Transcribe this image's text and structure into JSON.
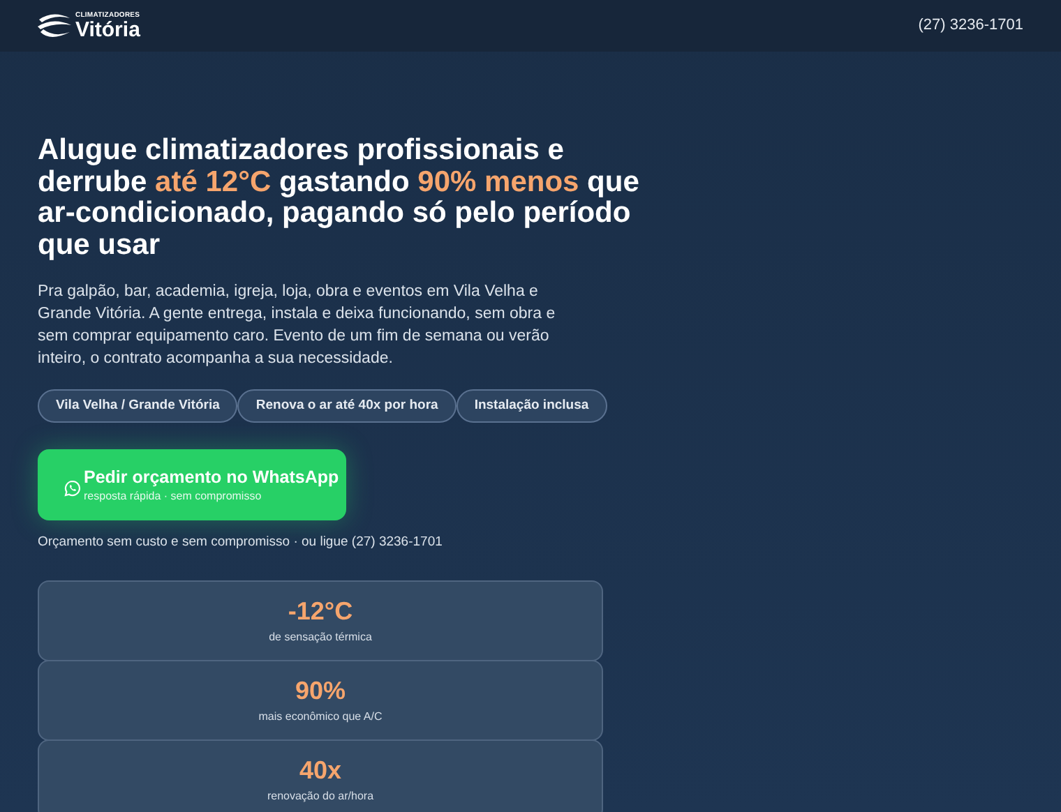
{
  "header": {
    "logo_small": "CLIMATIZADORES",
    "logo_big": "Vitória",
    "phone": "(27) 3236-1701"
  },
  "headline": [
    {
      "text": "Alugue climatizadores profissionais e derrube ",
      "accent": false
    },
    {
      "text": "até 12°C",
      "accent": true
    },
    {
      "text": " gastando ",
      "accent": false
    },
    {
      "text": "90% menos",
      "accent": true
    },
    {
      "text": " que ar-condicionado, pagando só pelo período que usar",
      "accent": false
    }
  ],
  "description": "Pra galpão, bar, academia, igreja, loja, obra e eventos em Vila Velha e Grande Vitória. A gente entrega, instala e deixa funcionando, sem obra e sem comprar equipamento caro. Evento de um fim de semana ou verão inteiro, o contrato acompanha a sua necessidade.",
  "chips": [
    "Vila Velha / Grande Vitória",
    "Renova o ar até 40x por hora",
    "Instalação inclusa"
  ],
  "cta": {
    "title": "Pedir orçamento no WhatsApp",
    "subtitle": "resposta rápida · sem compromisso"
  },
  "note": "Orçamento sem custo e sem compromisso · ou ligue (27) 3236-1701",
  "stats": [
    {
      "value": "-12°C",
      "label": "de sensação térmica"
    },
    {
      "value": "90%",
      "label": "mais econômico que A/C"
    },
    {
      "value": "40x",
      "label": "renovação do ar/hora"
    }
  ]
}
